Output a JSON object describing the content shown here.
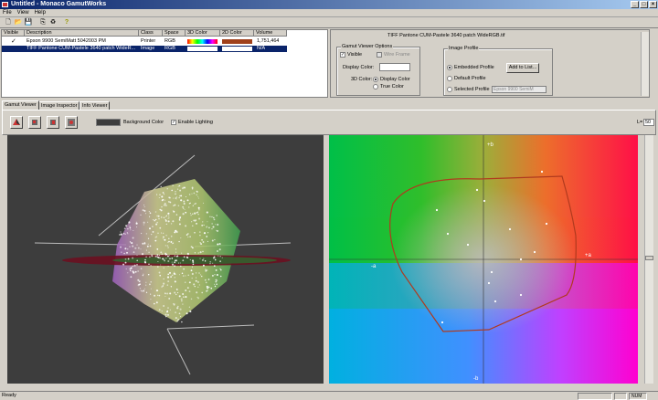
{
  "window": {
    "title": "Untitled - Monaco GamutWorks",
    "min": "_",
    "max": "□",
    "close": "×"
  },
  "menu": [
    "File",
    "View",
    "Help"
  ],
  "toolbar": {
    "icons": [
      "new-doc-icon",
      "open-folder-icon",
      "save-icon",
      "copy-icon",
      "recycle-icon",
      "help-icon"
    ],
    "glyphs": [
      "🗋",
      "📂",
      "💾",
      "⎘",
      "♻",
      "?"
    ]
  },
  "list": {
    "columns": [
      "Visible",
      "Description",
      "Class",
      "Space",
      "3D Color",
      "2D Color",
      "Volume"
    ],
    "rows": [
      {
        "visible": "✓",
        "description": "Epson 9900 SemiMatt 5042003 PM",
        "class": "Printer",
        "space": "RGB",
        "volume": "1,751,464",
        "selected": false
      },
      {
        "visible": "",
        "description": "TIFF Pantone CUM-Pastele 3640 patch WideR...",
        "class": "Image",
        "space": "RGB",
        "volume": "N/A",
        "selected": true
      }
    ]
  },
  "details": {
    "file_title": "TIFF Pantone CUM-Pastele 3640 patch WideRGB.tif",
    "gamut_options": {
      "title": "Gamut Viewer Options",
      "visible_label": "Visible",
      "visible_check": "✓",
      "wire_frame_label": "Wire Frame",
      "display_color_label": "Display Color:",
      "color_3d_label": "3D Color:",
      "display_color_opt": "Display Color",
      "true_color_opt": "True Color"
    },
    "image_profile": {
      "title": "Image Profile",
      "embedded": "Embedded Profile",
      "default": "Default Profile",
      "selected": "Selected Profile",
      "add_button": "Add to List...",
      "profile_select": "Epson 9900 SemiM"
    }
  },
  "tabs": [
    {
      "label": "Gamut Viewer",
      "active": true
    },
    {
      "label": "Image Inspector",
      "active": false
    },
    {
      "label": "Info Viewer",
      "active": false
    }
  ],
  "viewer": {
    "background_color_label": "Background Color",
    "enable_lighting_label": "Enable Lighting",
    "lighting_check": "✓",
    "l_label": "L=",
    "l_value": "50"
  },
  "plot2d": {
    "axis_plus_b": "+b",
    "axis_minus_b": "-b",
    "axis_plus_a": "+a",
    "axis_minus_a": "-a"
  },
  "status": {
    "text": "Ready",
    "num": "NUM"
  },
  "colors": {
    "selection": "#0a246a",
    "gamut_outline": "#b03a1e",
    "bg3d": "#3d3d3d"
  }
}
